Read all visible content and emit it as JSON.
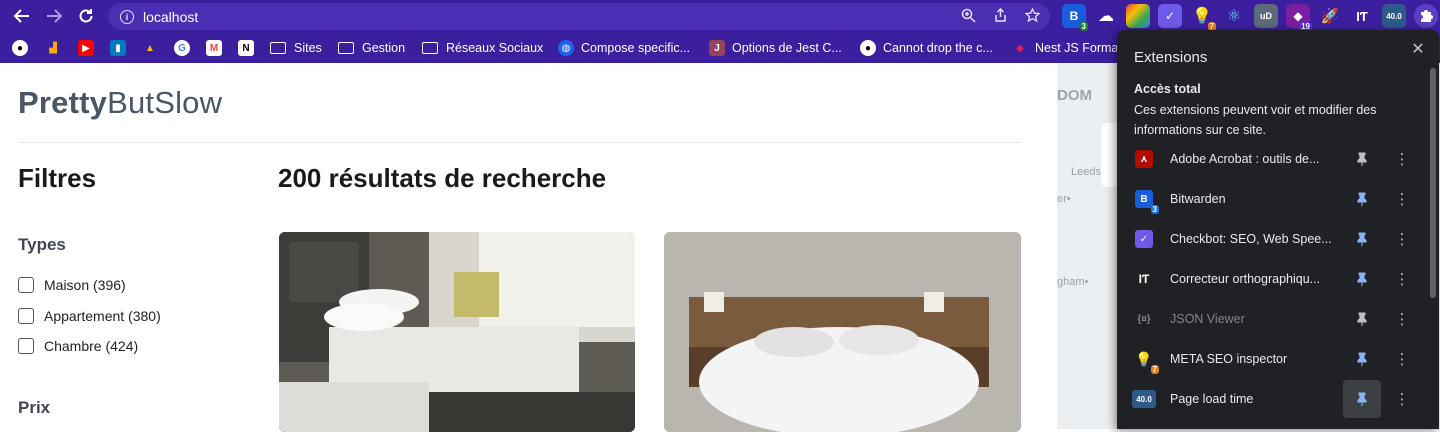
{
  "browser": {
    "url": "localhost",
    "bookmarks": [
      {
        "type": "site",
        "label": "",
        "icon": "github-icon"
      },
      {
        "type": "site",
        "label": "",
        "icon": "analytics-icon"
      },
      {
        "type": "site",
        "label": "",
        "icon": "youtube-icon"
      },
      {
        "type": "site",
        "label": "",
        "icon": "trello-icon"
      },
      {
        "type": "site",
        "label": "",
        "icon": "google-drive-icon"
      },
      {
        "type": "site",
        "label": "",
        "icon": "google-icon"
      },
      {
        "type": "site",
        "label": "",
        "icon": "gmail-icon"
      },
      {
        "type": "site",
        "label": "",
        "icon": "notion-icon"
      },
      {
        "type": "folder",
        "label": "Sites"
      },
      {
        "type": "folder",
        "label": "Gestion"
      },
      {
        "type": "folder",
        "label": "Réseaux Sociaux"
      },
      {
        "type": "site",
        "label": "Compose specific...",
        "icon": "compose-icon"
      },
      {
        "type": "site",
        "label": "Options de Jest C...",
        "icon": "jest-icon"
      },
      {
        "type": "site",
        "label": "Cannot drop the c...",
        "icon": "github-icon"
      },
      {
        "type": "site",
        "label": "Nest JS Forma",
        "icon": "nestjs-icon"
      }
    ],
    "toolbar_badges": {
      "bitwarden": "3",
      "meta_seo": "7",
      "notifications": "19",
      "page_load": "40.0"
    }
  },
  "page": {
    "logo_bold": "Pretty",
    "logo_rest": "ButSlow",
    "filters_title": "Filtres",
    "results_title": "200 résultats de recherche",
    "types_title": "Types",
    "types": [
      {
        "label": "Maison (396)",
        "checked": false
      },
      {
        "label": "Appartement (380)",
        "checked": false
      },
      {
        "label": "Chambre (424)",
        "checked": false
      }
    ],
    "prix_title": "Prix",
    "map_labels": [
      "DOM",
      "Leeds",
      "er•",
      "gham•"
    ]
  },
  "extensions_panel": {
    "title": "Extensions",
    "close_label": "✕",
    "section_title": "Accès total",
    "section_desc": "Ces extensions peuvent voir et modifier des informations sur ce site.",
    "items": [
      {
        "name": "Adobe Acrobat : outils de...",
        "icon": "adobe-acrobat-icon",
        "pinned": false,
        "disabled": false,
        "badge": ""
      },
      {
        "name": "Bitwarden",
        "icon": "bitwarden-icon",
        "pinned": true,
        "disabled": false,
        "badge": "3"
      },
      {
        "name": "Checkbot: SEO, Web Spee...",
        "icon": "checkbot-icon",
        "pinned": true,
        "disabled": false,
        "badge": ""
      },
      {
        "name": "Correcteur orthographiqu...",
        "icon": "languagetool-icon",
        "pinned": true,
        "disabled": false,
        "badge": ""
      },
      {
        "name": "JSON Viewer",
        "icon": "json-viewer-icon",
        "pinned": false,
        "disabled": true,
        "badge": ""
      },
      {
        "name": "META SEO inspector",
        "icon": "meta-seo-icon",
        "pinned": true,
        "disabled": false,
        "badge": "7"
      },
      {
        "name": "Page load time",
        "icon": "page-load-time-icon",
        "pinned": true,
        "disabled": false,
        "badge": "40.0"
      }
    ]
  },
  "colors": {
    "chrome": "#3b1f9e",
    "omnibox": "#4a2fb5",
    "panel_bg": "#202124",
    "pin_active": "#8ab4f8",
    "pin_inactive": "#bdc1c6"
  }
}
